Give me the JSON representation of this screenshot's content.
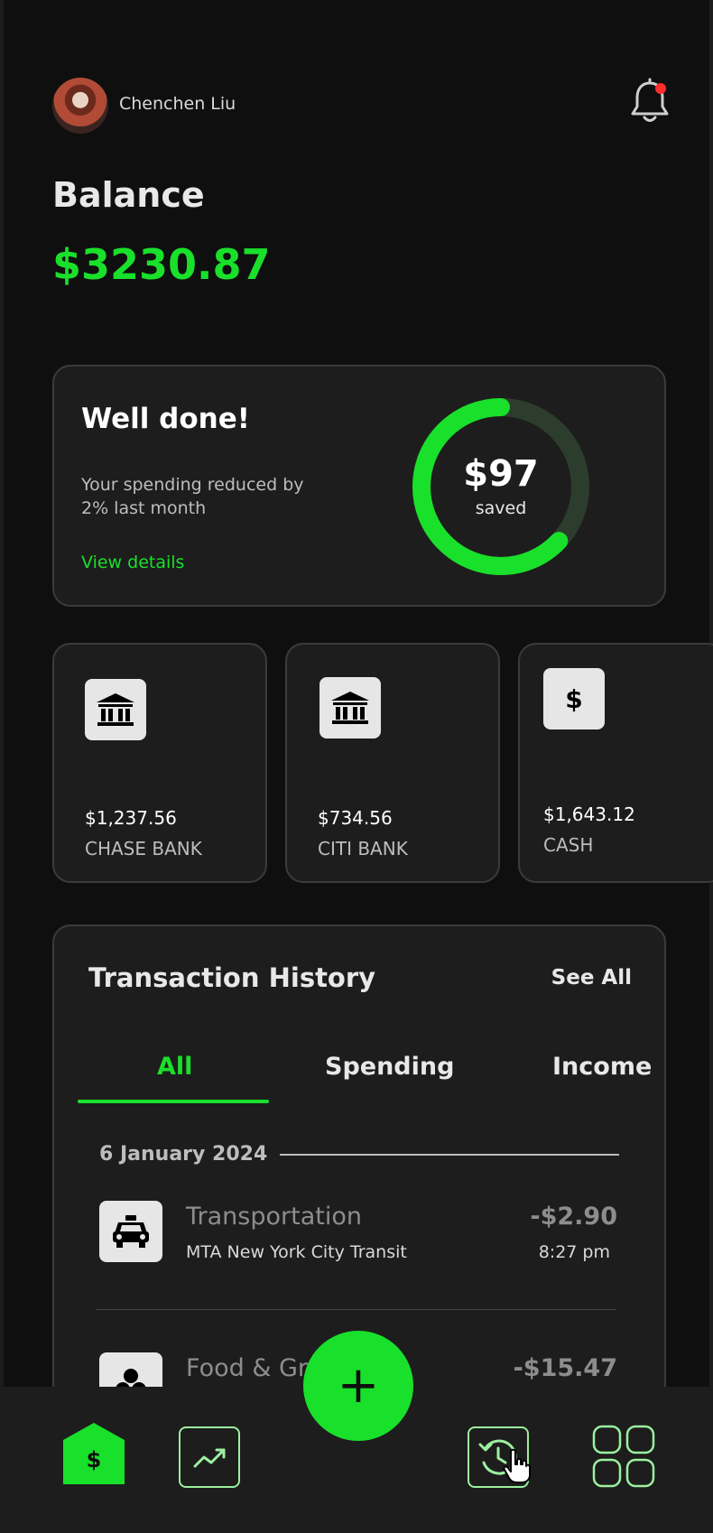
{
  "header": {
    "username": "Chenchen Liu"
  },
  "balance": {
    "label": "Balance",
    "value": "$3230.87"
  },
  "savings": {
    "title": "Well done!",
    "message": "Your spending reduced by 2% last month",
    "link": "View details",
    "amount": "$97",
    "amount_label": "saved",
    "ring_progress": 0.63
  },
  "accounts": [
    {
      "icon": "bank-icon",
      "amount": "$1,237.56",
      "name": "CHASE BANK"
    },
    {
      "icon": "bank-icon",
      "amount": "$734.56",
      "name": "CITI BANK"
    },
    {
      "icon": "dollar-icon",
      "symbol": "$",
      "amount": "$1,643.12",
      "name": "CASH"
    }
  ],
  "transactions": {
    "title": "Transaction History",
    "see_all": "See All",
    "tabs": [
      {
        "label": "All",
        "active": true
      },
      {
        "label": "Spending",
        "active": false
      },
      {
        "label": "Income",
        "active": false
      }
    ],
    "date": "6 January 2024",
    "items": [
      {
        "icon": "taxi-icon",
        "category": "Transportation",
        "merchant": "MTA New York City Transit",
        "amount": "-$2.90",
        "time": "8:27 pm"
      },
      {
        "icon": "food-icon",
        "category": "Food & Groceries",
        "amount": "-$15.47"
      }
    ]
  },
  "nav": {
    "home_symbol": "$",
    "fab_symbol": "+",
    "items": [
      "home-icon",
      "trend-icon",
      "history-icon",
      "grid-icon"
    ]
  },
  "colors": {
    "accent": "#19e02a",
    "background": "#0f0f0f",
    "card": "#1d1d1d"
  }
}
